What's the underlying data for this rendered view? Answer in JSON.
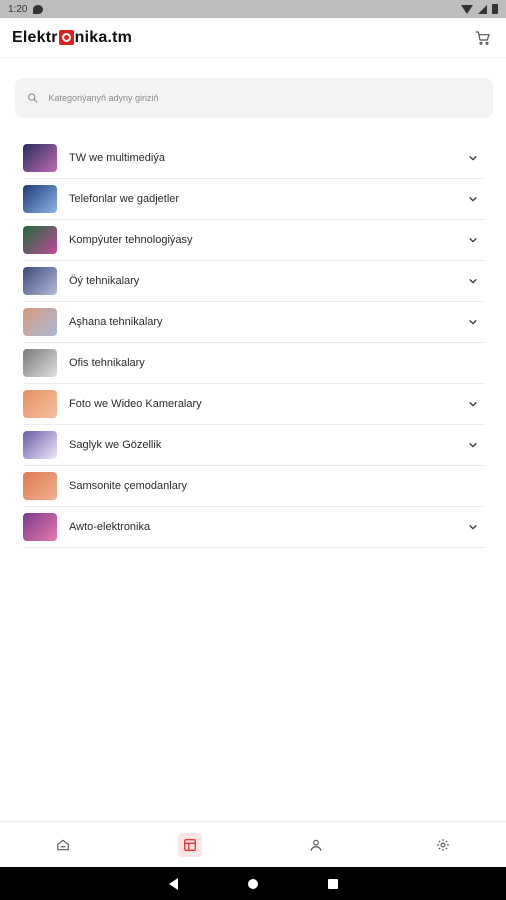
{
  "status_bar": {
    "time": "1:20",
    "icons": [
      "message-icon",
      "wifi-icon",
      "signal-icon",
      "battery-icon"
    ]
  },
  "header": {
    "logo_prefix": "Elektr",
    "logo_suffix": "nika.tm",
    "cart_icon": "cart-icon"
  },
  "search": {
    "placeholder": "Kategoriýanyň adyny giriziň",
    "value": ""
  },
  "categories": [
    {
      "label": "TW we multimediýa",
      "expandable": true,
      "thumb_colors": [
        "#2a2d5c",
        "#c06bb8"
      ]
    },
    {
      "label": "Telefonlar we gadjetler",
      "expandable": true,
      "thumb_colors": [
        "#1f3a78",
        "#8cb6e8"
      ]
    },
    {
      "label": "Kompýuter tehnologiýasy",
      "expandable": true,
      "thumb_colors": [
        "#1e6a3a",
        "#c24a9a"
      ]
    },
    {
      "label": "Öý tehnikalary",
      "expandable": true,
      "thumb_colors": [
        "#3c4a7c",
        "#b4bcd8"
      ]
    },
    {
      "label": "Aşhana tehnikalary",
      "expandable": true,
      "thumb_colors": [
        "#d89a7a",
        "#a8b8d8"
      ]
    },
    {
      "label": "Ofis tehnikalary",
      "expandable": false,
      "thumb_colors": [
        "#7a7a7a",
        "#e0e0e0"
      ]
    },
    {
      "label": "Foto we Wideo Kameralary",
      "expandable": true,
      "thumb_colors": [
        "#e89060",
        "#f4c0a0"
      ]
    },
    {
      "label": "Saglyk we Gözellik",
      "expandable": true,
      "thumb_colors": [
        "#6a5aa8",
        "#f0e8f8"
      ]
    },
    {
      "label": "Samsonite çemodanlary",
      "expandable": false,
      "thumb_colors": [
        "#e07a50",
        "#f0b090"
      ]
    },
    {
      "label": "Awto-elektronika",
      "expandable": true,
      "thumb_colors": [
        "#7a3a8a",
        "#e87ab0"
      ]
    }
  ],
  "bottom_nav": [
    {
      "name": "home-icon",
      "active": false
    },
    {
      "name": "catalog-icon",
      "active": true
    },
    {
      "name": "profile-icon",
      "active": false
    },
    {
      "name": "settings-icon",
      "active": false
    }
  ],
  "colors": {
    "accent": "#e02020",
    "active_bg": "#fde5e5"
  }
}
